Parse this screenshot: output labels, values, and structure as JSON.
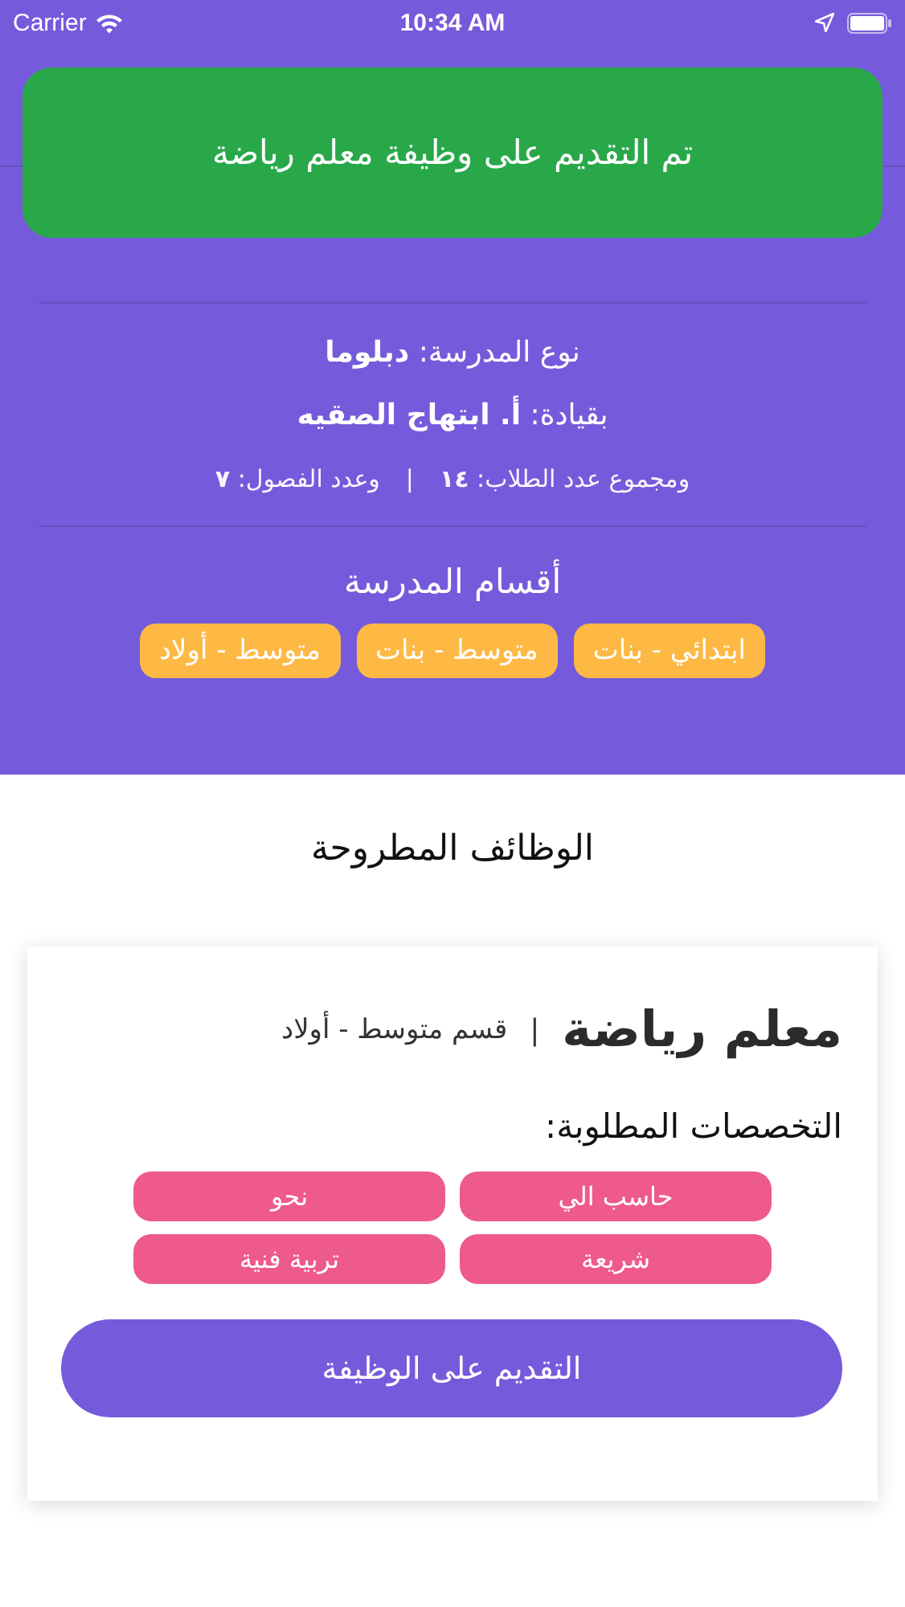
{
  "status_bar": {
    "carrier": "Carrier",
    "time": "10:34 AM"
  },
  "toast": {
    "message": "تم التقديم على وظيفة معلم رياضة"
  },
  "school": {
    "type_line": "نوع المدرسة: **دبلوما**",
    "leader_line": "بقيادة: **أ. ابتهاج الصقيه**",
    "students": "ومجموع عدد الطلاب: **١٤**",
    "separator": "|",
    "classes": "وعدد الفصول: **٧**",
    "sections_title": "أقسام المدرسة",
    "sections": [
      "ابتدائي - بنات",
      "متوسط - بنات",
      "متوسط - أولاد"
    ]
  },
  "jobs_title": "الوظائف المطروحة",
  "job": {
    "title": "معلم رياضة",
    "separator": "|",
    "department": "قسم متوسط - أولاد",
    "specialties_label": "التخصصات المطلوبة:",
    "specialties": [
      "حاسب الي",
      "نحو",
      "شريعة",
      "تربية فنية"
    ],
    "apply_button": "التقديم على الوظيفة"
  }
}
